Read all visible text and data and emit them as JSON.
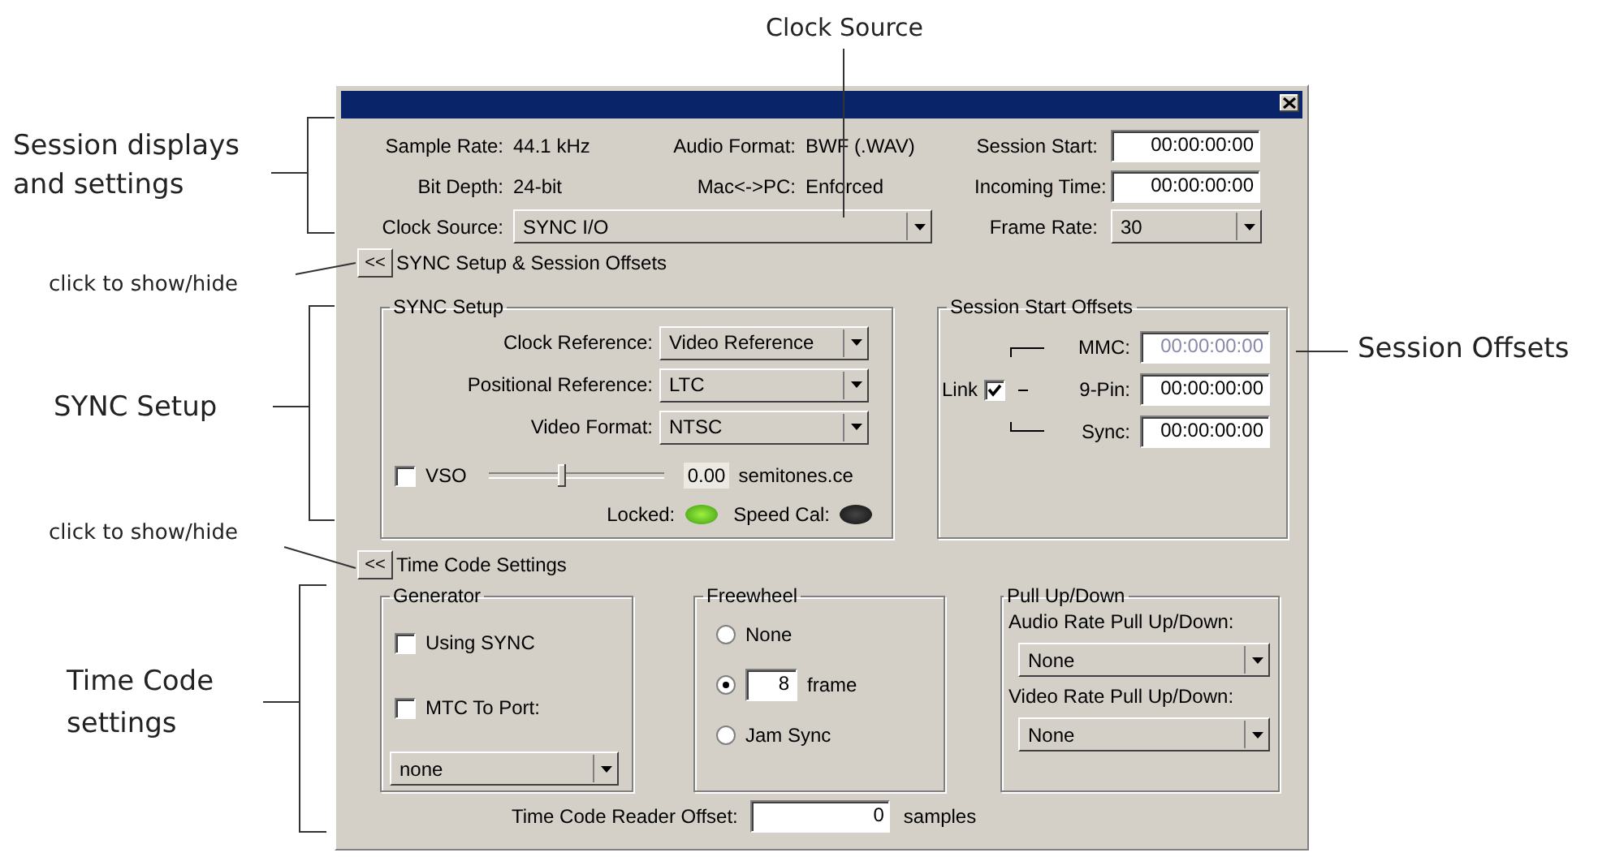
{
  "session_info": [
    {
      "label": "Sample Rate:",
      "value": "44.1 kHz"
    },
    {
      "label": "Audio Format:",
      "value": "BWF (.WAV)"
    },
    {
      "label": "Bit Depth:",
      "value": "24-bit"
    },
    {
      "label": "Mac<->PC:",
      "value": "Enforced"
    }
  ],
  "session_times": [
    {
      "label": "Session Start:",
      "value": "00:00:00:00"
    },
    {
      "label": "Incoming Time:",
      "value": "00:00:00:00"
    }
  ],
  "clock_source": {
    "label": "Clock Source:",
    "value": "SYNC I/O"
  },
  "frame_rate": {
    "label": "Frame Rate:",
    "value": "30"
  },
  "sync_toggle": {
    "button": "<<",
    "label": "SYNC Setup & Session Offsets"
  },
  "sync_setup": {
    "title": "SYNC Setup",
    "dropdowns": [
      {
        "label": "Clock Reference:",
        "value": "Video Reference"
      },
      {
        "label": "Positional Reference:",
        "value": "LTC"
      },
      {
        "label": "Video Format:",
        "value": "NTSC"
      }
    ],
    "vso": {
      "label": "VSO",
      "checked": false,
      "level": 0.4,
      "reading": "0.00",
      "unit": "semitones.ce"
    },
    "indicators": [
      {
        "label": "Locked:",
        "on": true
      },
      {
        "label": "Speed Cal:",
        "on": false
      }
    ]
  },
  "session_offsets": {
    "title": "Session Start Offsets",
    "link": {
      "label": "Link",
      "checked": true
    },
    "fields": [
      {
        "label": "MMC:",
        "value": "00:00:00:00",
        "disabled": true
      },
      {
        "label": "9-Pin:",
        "value": "00:00:00:00",
        "disabled": false
      },
      {
        "label": "Sync:",
        "value": "00:00:00:00",
        "disabled": false
      }
    ]
  },
  "timecode_toggle": {
    "button": "<<",
    "label": "Time Code Settings"
  },
  "generator": {
    "title": "Generator",
    "options": [
      {
        "label": "Using SYNC",
        "checked": false
      },
      {
        "label": "MTC To Port:",
        "checked": false
      }
    ],
    "port": "none"
  },
  "freewheel": {
    "title": "Freewheel",
    "options": [
      {
        "kind": "plain",
        "label": "None",
        "selected": false
      },
      {
        "kind": "frames",
        "value": "8",
        "label": "frame",
        "selected": true
      },
      {
        "kind": "plain",
        "label": "Jam Sync",
        "selected": false
      }
    ]
  },
  "pull": {
    "title": "Pull Up/Down",
    "dropdowns": [
      {
        "label": "Audio Rate Pull Up/Down:",
        "value": "None"
      },
      {
        "label": "Video Rate Pull Up/Down:",
        "value": "None"
      }
    ]
  },
  "reader_offset": {
    "label": "Time Code Reader Offset:",
    "value": "0",
    "unit": "samples"
  },
  "callouts": [
    {
      "text": "Clock Source"
    },
    {
      "text": "Session displays and settings"
    },
    {
      "text": "click to show/hide"
    },
    {
      "text": "SYNC Setup"
    },
    {
      "text": "click to show/hide"
    },
    {
      "text": "Time Code settings"
    },
    {
      "text": "Session Offsets"
    }
  ]
}
